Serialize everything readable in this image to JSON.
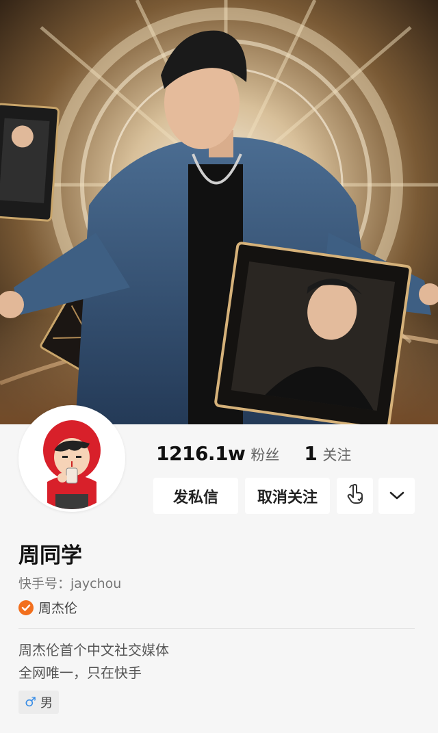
{
  "profile": {
    "cover_description": "Cover photo",
    "avatar_description": "Cartoon avatar",
    "stats": {
      "followers_value": "1216.1w",
      "followers_label": "粉丝",
      "following_value": "1",
      "following_label": "关注"
    },
    "actions": {
      "message_label": "发私信",
      "unfollow_label": "取消关注",
      "touch_icon": "hand-touch-icon",
      "more_icon": "chevron-down-icon"
    },
    "name": "周同学",
    "account_id": "快手号：jaychou",
    "verified": {
      "icon": "verified-check-icon",
      "text": "周杰伦",
      "color": "#f26f1d"
    },
    "bio": [
      "周杰伦首个中文社交媒体",
      "全网唯一，只在快手"
    ],
    "gender": {
      "icon": "male-icon",
      "label": "男",
      "color": "#3a8ee6"
    }
  },
  "colors": {
    "page_background": "#f6f6f6",
    "button_background": "#ffffff",
    "text_primary": "#111111",
    "text_secondary": "#777777"
  }
}
